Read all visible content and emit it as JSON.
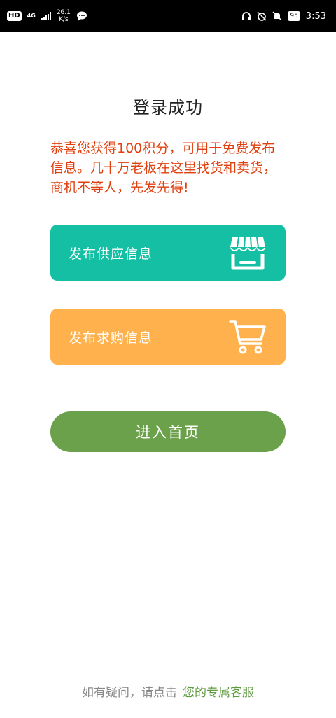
{
  "status_bar": {
    "hd": "HD",
    "network": "4G",
    "speed_value": "26.1",
    "speed_unit": "K/s",
    "battery": "95",
    "time": "3:53",
    "icons": [
      "hd-icon",
      "signal-icon",
      "chat-icon",
      "headphones-icon",
      "alarm-icon",
      "mute-icon",
      "battery-icon"
    ]
  },
  "page": {
    "title": "登录成功",
    "congrats_text": "恭喜您获得100积分，可用于免费发布信息。几十万老板在这里找货和卖货，商机不等人，先发先得!"
  },
  "cards": {
    "supply_label": "发布供应信息",
    "supply_icon": "storefront-icon",
    "demand_label": "发布求购信息",
    "demand_icon": "cart-icon"
  },
  "home_button": {
    "label": "进入首页"
  },
  "footer": {
    "prompt": "如有疑问，请点击",
    "link": "您的专属客服"
  },
  "colors": {
    "status_bar_bg": "#000000",
    "title_text": "#222222",
    "congrats_text": "#e0400f",
    "supply_card": "#14bfa3",
    "demand_card": "#ffb14d",
    "home_button": "#6aa14a",
    "footer_text": "#888888",
    "footer_link": "#5e9a3f"
  }
}
